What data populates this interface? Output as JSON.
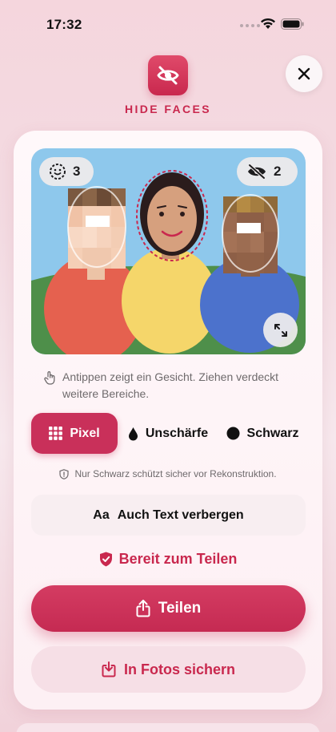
{
  "status": {
    "time": "17:32"
  },
  "app": {
    "title": "HIDE FACES"
  },
  "photo": {
    "faces_count": "3",
    "hidden_count": "2"
  },
  "hint": {
    "text": "Antippen zeigt ein Gesicht. Ziehen verdeckt weitere Bereiche."
  },
  "modes": [
    {
      "label": "Pixel",
      "icon": "grid-icon",
      "selected": true
    },
    {
      "label": "Unschärfe",
      "icon": "drop-icon",
      "selected": false
    },
    {
      "label": "Schwarz",
      "icon": "circle-icon",
      "selected": false
    }
  ],
  "note": {
    "text": "Nur Schwarz schützt sicher vor Rekonstruktion."
  },
  "text_toggle": {
    "prefix": "Aa",
    "label": "Auch Text verbergen"
  },
  "ready": {
    "label": "Bereit zum Teilen"
  },
  "actions": {
    "share": "Teilen",
    "save": "In Fotos sichern"
  },
  "colors": {
    "accent": "#c9284e",
    "accent_light": "#f6dfe6",
    "sky": "#8ec8ec",
    "grass": "#4e8f4a"
  }
}
